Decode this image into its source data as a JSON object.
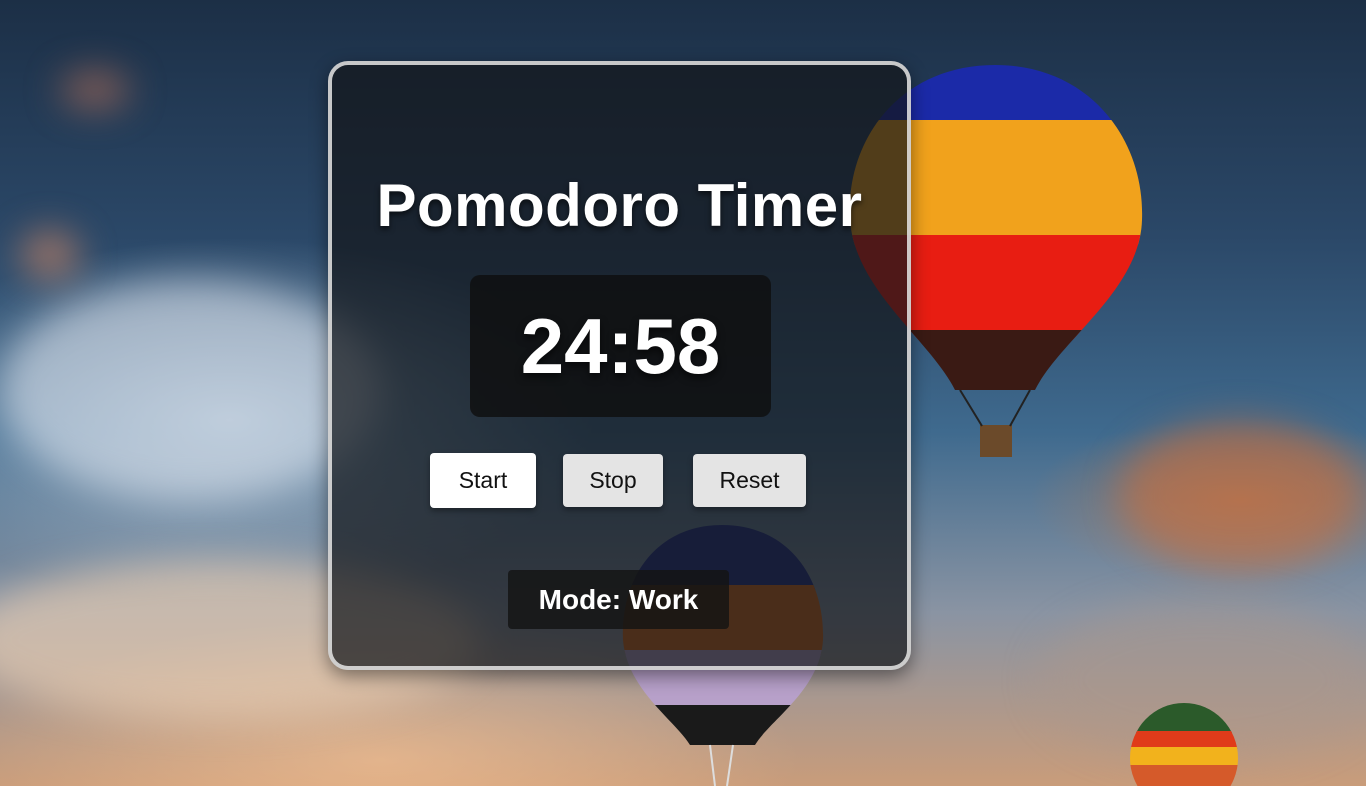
{
  "title": "Pomodoro Timer",
  "timer": {
    "display": "24:58"
  },
  "controls": {
    "start_label": "Start",
    "stop_label": "Stop",
    "reset_label": "Reset"
  },
  "mode": {
    "text": "Mode: Work"
  },
  "background": {
    "description_icon": "hot-air-balloons-sky-photo",
    "colors": {
      "sky_top": "#1c2f46",
      "sky_mid": "#3f6a8e",
      "sunset": "#c99c7a"
    }
  },
  "theme": {
    "card_bg": "#14161a",
    "card_border": "#e6e6e6",
    "button_primary": "#ffffff",
    "button_secondary": "#e4e4e4"
  }
}
